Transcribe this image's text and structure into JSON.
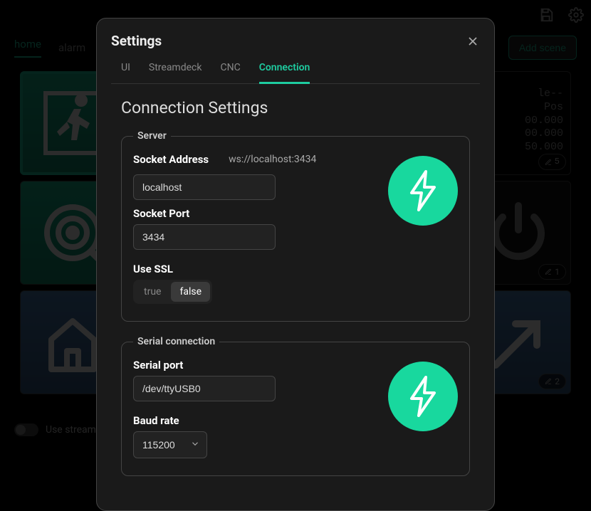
{
  "top": {
    "add_scene": "Add scene"
  },
  "bg_tabs": {
    "home": "home",
    "alarm": "alarm"
  },
  "tiles": {
    "text_tile": {
      "line1": "le--",
      "line2": " Pos",
      "line3": "00.000",
      "line4": "00.000",
      "line5": "50.000"
    },
    "badge5": "5",
    "badge1": "1",
    "badge2": "2"
  },
  "streamdeck_label": "Use streamd",
  "modal": {
    "title": "Settings",
    "tabs": {
      "ui": "UI",
      "streamdeck": "Streamdeck",
      "cnc": "CNC",
      "connection": "Connection"
    },
    "section_title": "Connection Settings",
    "server": {
      "legend": "Server",
      "socket_address_label": "Socket Address",
      "socket_address_value": "ws://localhost:3434",
      "host_value": "localhost",
      "socket_port_label": "Socket Port",
      "port_value": "3434",
      "use_ssl_label": "Use SSL",
      "ssl_true": "true",
      "ssl_false": "false"
    },
    "serial": {
      "legend": "Serial connection",
      "serial_port_label": "Serial port",
      "serial_port_value": "/dev/ttyUSB0",
      "baud_rate_label": "Baud rate",
      "baud_rate_value": "115200"
    }
  }
}
